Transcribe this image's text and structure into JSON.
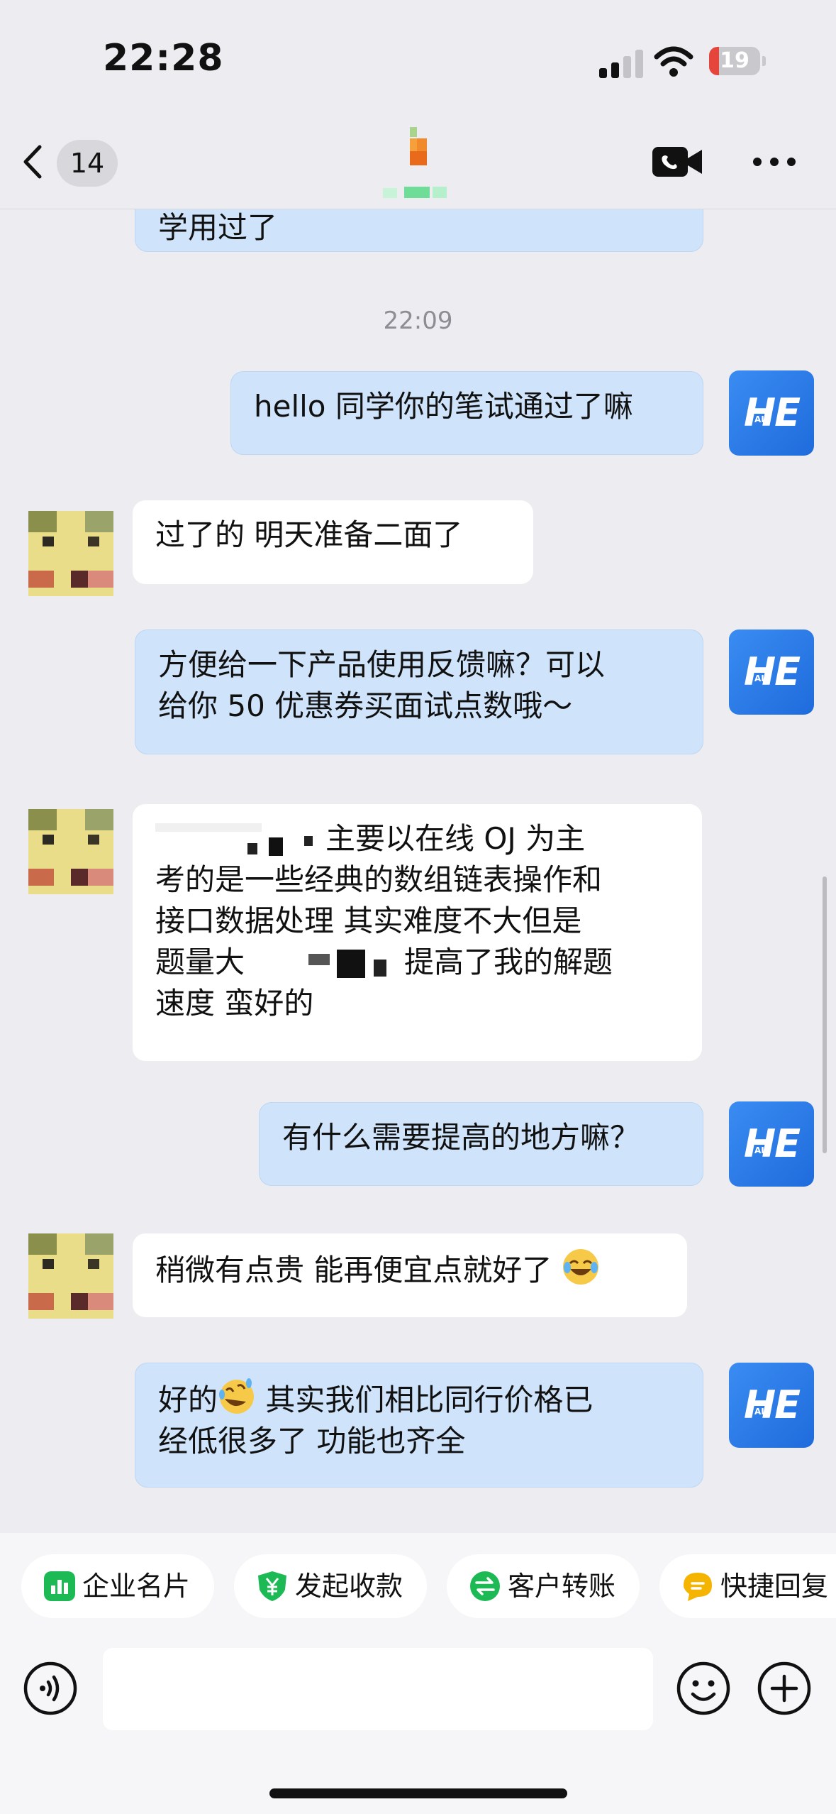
{
  "status_bar": {
    "time": "22:28",
    "battery": "19",
    "battery_fraction": 0.19
  },
  "nav": {
    "badge_count": "14"
  },
  "chat": {
    "partial_text": "学用过了",
    "timestamp": "22:09",
    "messages": [
      {
        "from": "me",
        "lines": [
          "hello 同学你的笔试通过了嘛"
        ]
      },
      {
        "from": "them",
        "lines": [
          "过了的 明天准备二面了"
        ]
      },
      {
        "from": "me",
        "lines": [
          "方便给一下产品使用反馈嘛？可以",
          "给你 50 优惠券买面试点数哦～"
        ]
      },
      {
        "from": "them",
        "lines": [
          "主要以在线 OJ 为主",
          "考的是一些经典的数组链表操作和",
          "接口数据处理 其实难度不大但是",
          "题量大",
          "提高了我的解题",
          "速度 蛮好的"
        ]
      },
      {
        "from": "me",
        "lines": [
          "有什么需要提高的地方嘛？"
        ]
      },
      {
        "from": "them",
        "lines": [
          "稍微有点贵  能再便宜点就好了"
        ]
      },
      {
        "from": "me",
        "lines": [
          "好的",
          " 其实我们相比同行价格已",
          "经低很多了 功能也齐全"
        ]
      }
    ]
  },
  "my_avatar": {
    "logo": "HE",
    "sub": "AI"
  },
  "quick_actions": [
    {
      "label": "企业名片",
      "icon": "business-card-icon",
      "color": "#1db954"
    },
    {
      "label": "发起收款",
      "icon": "yen-shield-icon",
      "color": "#1db954"
    },
    {
      "label": "客户转账",
      "icon": "transfer-icon",
      "color": "#1db954"
    },
    {
      "label": "快捷回复",
      "icon": "quick-reply-icon",
      "color": "#f5b400"
    }
  ],
  "input": {
    "placeholder": ""
  },
  "colors": {
    "accent": "#2f7ef0",
    "out_bubble": "#cfe4fb",
    "in_bubble": "#ffffff",
    "background": "#ededf1"
  }
}
